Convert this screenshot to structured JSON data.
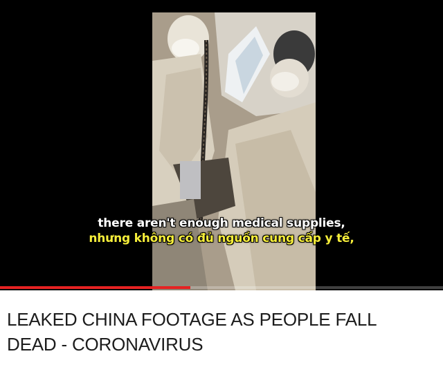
{
  "video": {
    "subtitle_en": "there aren't enough medical supplies,",
    "subtitle_vi": "nhưng không có đủ nguồn cung cấp y tế,",
    "progress_fraction": 0.43,
    "progress_color": "#e52222"
  },
  "title": "LEAKED CHINA FOOTAGE AS PEOPLE FALL DEAD - CORONAVIRUS"
}
